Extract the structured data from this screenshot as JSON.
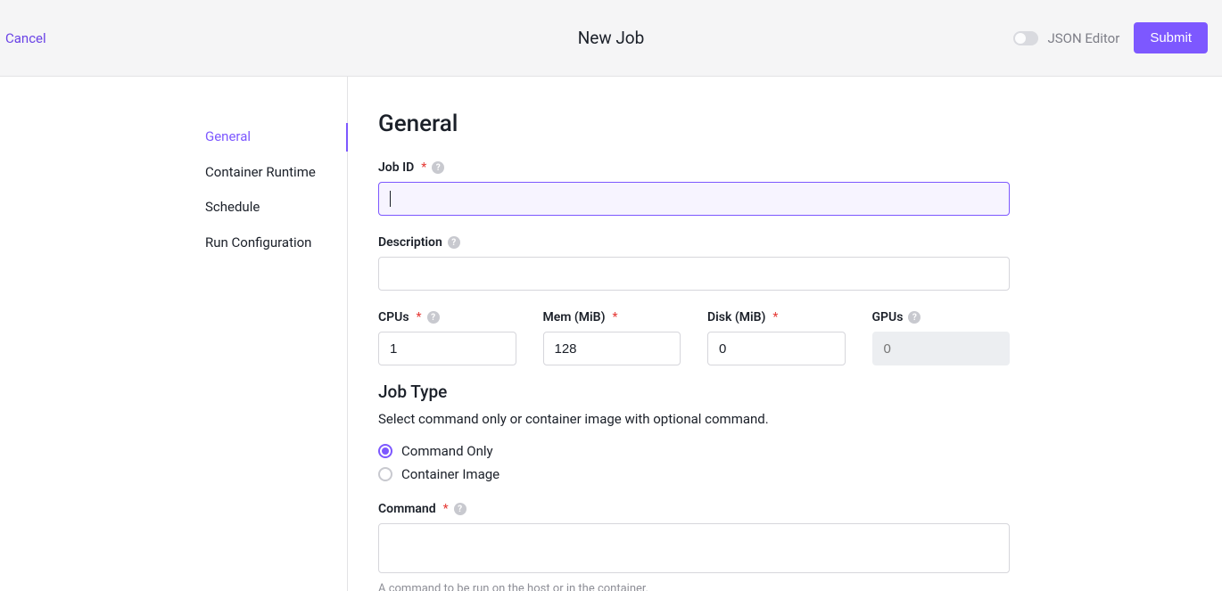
{
  "header": {
    "cancel": "Cancel",
    "title": "New Job",
    "json_editor_label": "JSON Editor",
    "submit": "Submit"
  },
  "sidebar": {
    "items": [
      {
        "label": "General",
        "active": true
      },
      {
        "label": "Container Runtime",
        "active": false
      },
      {
        "label": "Schedule",
        "active": false
      },
      {
        "label": "Run Configuration",
        "active": false
      }
    ]
  },
  "form": {
    "section_title": "General",
    "job_id": {
      "label": "Job ID",
      "value": ""
    },
    "description": {
      "label": "Description",
      "value": ""
    },
    "cpus": {
      "label": "CPUs",
      "value": "1"
    },
    "mem": {
      "label": "Mem (MiB)",
      "value": "128"
    },
    "disk": {
      "label": "Disk (MiB)",
      "value": "0"
    },
    "gpus": {
      "label": "GPUs",
      "placeholder": "0"
    },
    "job_type": {
      "title": "Job Type",
      "desc": "Select command only or container image with optional command.",
      "options": [
        {
          "label": "Command Only",
          "selected": true
        },
        {
          "label": "Container Image",
          "selected": false
        }
      ]
    },
    "command": {
      "label": "Command",
      "value": "",
      "hint": "A command to be run on the host or in the container."
    }
  }
}
